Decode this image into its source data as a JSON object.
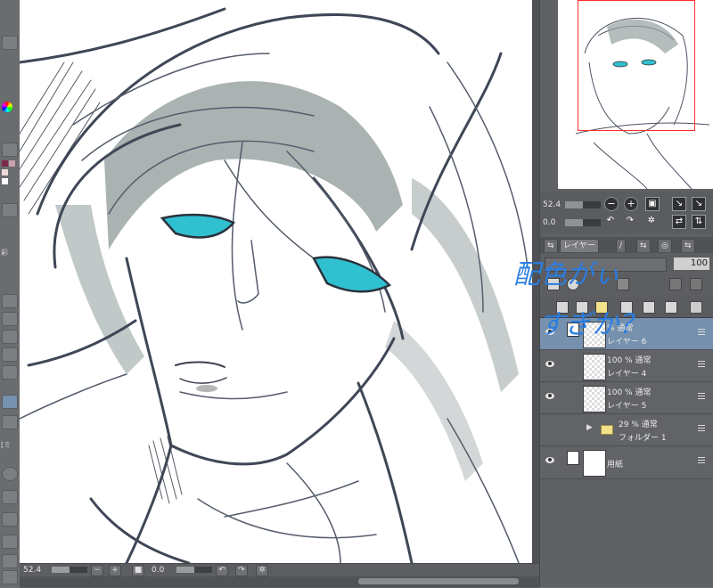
{
  "colors": {
    "accent_hand": "#2a7de1",
    "nav_frame": "#ff2a2a",
    "selected_layer": "#7591ad"
  },
  "left_strip": {
    "label_a": "彩",
    "label_b": "[ミ"
  },
  "status": {
    "zoom": "52.4",
    "angle": "0.0"
  },
  "navigator": {
    "zoom": "52.4",
    "angle": "0.0"
  },
  "layer_panel": {
    "tab_label": "レイヤー",
    "opacity": "100",
    "layers": [
      {
        "mode": "% 通常",
        "name": "レイヤー 6",
        "selected": true
      },
      {
        "mode": "100 % 通常",
        "name": "レイヤー 4"
      },
      {
        "mode": "100 % 通常",
        "name": "レイヤー 5"
      },
      {
        "mode": "29 % 通常",
        "name": "フォルダー 1",
        "folder": true
      },
      {
        "mode": "",
        "name": "用紙",
        "paper": true
      }
    ]
  },
  "annotation": {
    "line1": "配色がぃ",
    "line2": "すぎか？"
  }
}
